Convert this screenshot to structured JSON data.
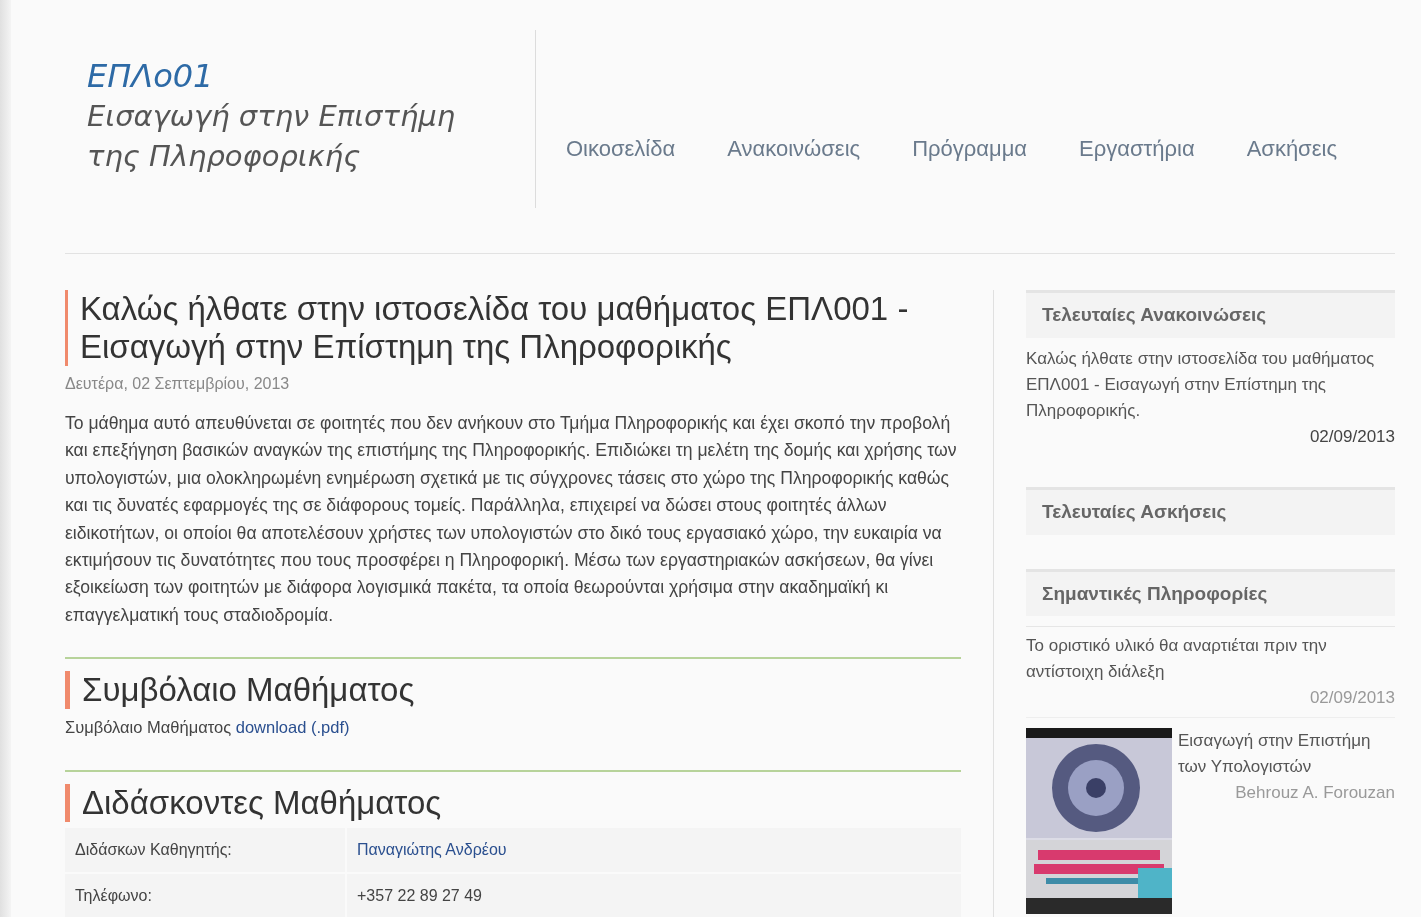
{
  "logo": {
    "code": "ΕΠΛο01",
    "title": "Εισαγωγή στην Επιστήμη της Πληροφορικής"
  },
  "nav": [
    "Οικοσελίδα",
    "Ανακοινώσεις",
    "Πρόγραμμα",
    "Εργαστήρια",
    "Ασκήσεις"
  ],
  "article": {
    "title": "Καλώς ήλθατε στην ιστοσελίδα του μαθήματος ΕΠΛ001 - Εισαγωγή στην Επίστημη της Πληροφορικής",
    "date": "Δευτέρα, 02 Σεπτεμβρίου, 2013",
    "body": "Το μάθημα αυτό απευθύνεται σε φοιτητές που δεν ανήκουν στο Τμήμα Πληροφορικής και έχει σκοπό την προβολή και επεξήγηση βασικών αναγκών της επιστήμης της Πληροφορικής. Επιδιώκει τη μελέτη της δομής και χρήσης των υπολογιστών, μια ολοκληρωμένη ενημέρωση σχετικά με τις σύγχρονες τάσεις στο χώρο της Πληροφορικής καθώς και τις δυνατές εφαρμογές της σε διάφορους τομείς. Παράλληλα, επιχειρεί να δώσει στους φοιτητές άλλων ειδικοτήτων, οι οποίοι θα αποτελέσουν χρήστες των υπολογιστών στο δικό τους εργασιακό χώρο, την ευκαιρία να εκτιμήσουν τις δυνατότητες που τους προσφέρει η Πληροφορική. Μέσω των εργαστηριακών ασκήσεων, θα γίνει εξοικείωση των φοιτητών με διάφορα λογισμικά πακέτα, τα οποία θεωρούνται χρήσιμα στην ακαδημαϊκή κι επαγγελματική τους σταδιοδρομία."
  },
  "contract": {
    "title": "Συμβόλαιο Μαθήματος",
    "text": "Συμβόλαιο Μαθήματος",
    "link": "download (.pdf)"
  },
  "instructors": {
    "title": "Διδάσκοντες Μαθήματος",
    "rows": [
      {
        "label": "Διδάσκων Καθηγητής:",
        "value": "Παναγιώτης Ανδρέου",
        "kind": "link"
      },
      {
        "label": "Τηλέφωνο:",
        "value": "+357 22 89 27 49",
        "kind": "text"
      }
    ]
  },
  "sidebar": {
    "announcements": {
      "title": "Τελευταίες Ανακοινώσεις",
      "items": [
        {
          "text": "Καλώς ήλθατε στην ιστοσελίδα του μαθήματος ΕΠΛ001 - Εισαγωγή στην Επίστημη της Πληροφορικής.",
          "date": "02/09/2013"
        }
      ]
    },
    "exercises": {
      "title": "Τελευταίες Ασκήσεις"
    },
    "info": {
      "title": "Σημαντικές Πληροφορίες",
      "items": [
        {
          "text": "Το οριστικό υλικό θα αναρτιέται πριν την αντίστοιχη διάλεξη",
          "date": "02/09/2013"
        }
      ]
    },
    "book": {
      "kind": "picture",
      "title": "Εισαγωγή στην Επιστήμη των Υπολογιστών",
      "author": "Behrouz A. Forouzan"
    }
  }
}
